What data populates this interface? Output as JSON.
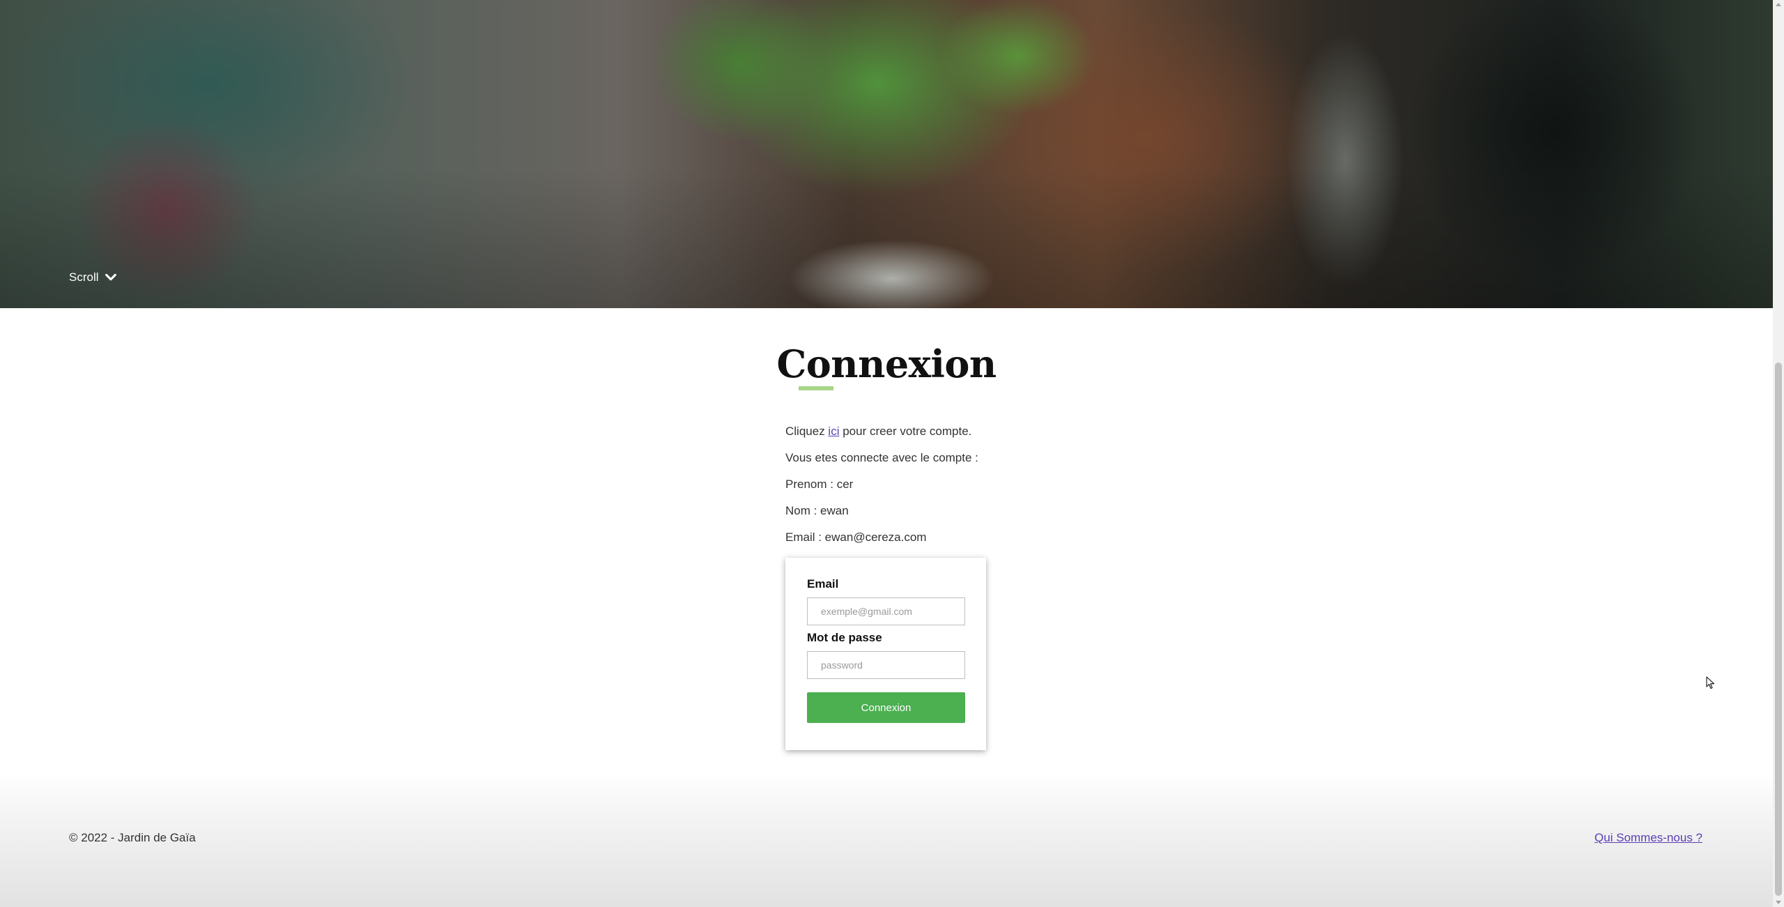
{
  "hero": {
    "scroll_label": "Scroll",
    "scroll_icon": "chevron-down-icon"
  },
  "main": {
    "title": "Connexion",
    "create_account": {
      "prefix": "Cliquez ",
      "link": "ici",
      "suffix": " pour creer votre compte."
    },
    "connected_as": "Vous etes connecte avec le compte :",
    "prenom": "Prenom : cer",
    "nom": "Nom : ewan",
    "email": "Email : ewan@cereza.com"
  },
  "login_form": {
    "email_label": "Email",
    "email_placeholder": "exemple@gmail.com",
    "email_value": "",
    "password_label": "Mot de passe",
    "password_placeholder": "password",
    "password_value": "",
    "submit_label": "Connexion"
  },
  "footer": {
    "copyright": "© 2022 - Jardin de Gaïa",
    "about_link": "Qui Sommes-nous ?"
  },
  "colors": {
    "accent": "#4caf50",
    "title_underline": "#a8d58a",
    "link": "#5a3fb6"
  }
}
